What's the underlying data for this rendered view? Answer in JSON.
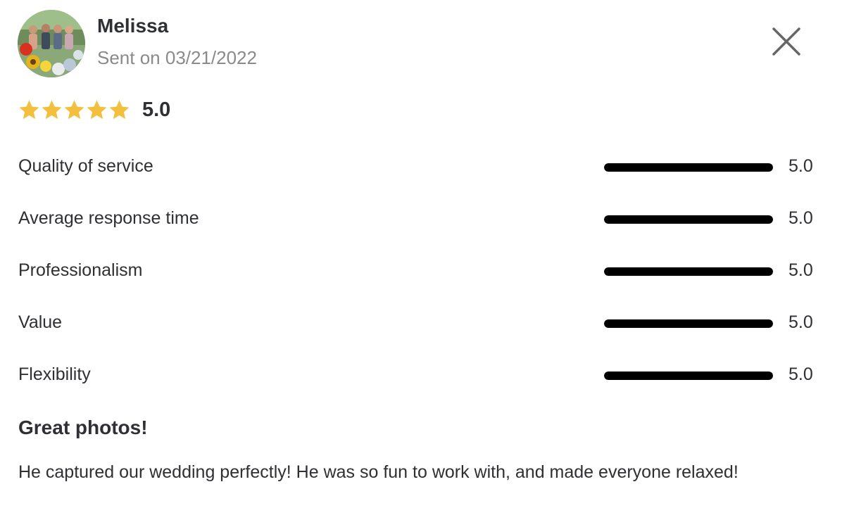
{
  "reviewer": {
    "name": "Melissa",
    "sent": "Sent on 03/21/2022",
    "avatar": "avatar-photo-icon"
  },
  "close": {
    "icon": "close-icon"
  },
  "overall": {
    "stars": 5,
    "max_stars": 5,
    "score": "5.0",
    "star_color": "#f3c03e"
  },
  "ratings": [
    {
      "label": "Quality of service",
      "value": "5.0",
      "fraction": 1.0
    },
    {
      "label": "Average response time",
      "value": "5.0",
      "fraction": 1.0
    },
    {
      "label": "Professionalism",
      "value": "5.0",
      "fraction": 1.0
    },
    {
      "label": "Value",
      "value": "5.0",
      "fraction": 1.0
    },
    {
      "label": "Flexibility",
      "value": "5.0",
      "fraction": 1.0
    }
  ],
  "review": {
    "title": "Great photos!",
    "body": "He captured our wedding perfectly! He was so fun to work with, and made everyone relaxed!"
  },
  "colors": {
    "text": "#2f3033",
    "muted": "#8a8a8a",
    "bar": "#000000"
  }
}
